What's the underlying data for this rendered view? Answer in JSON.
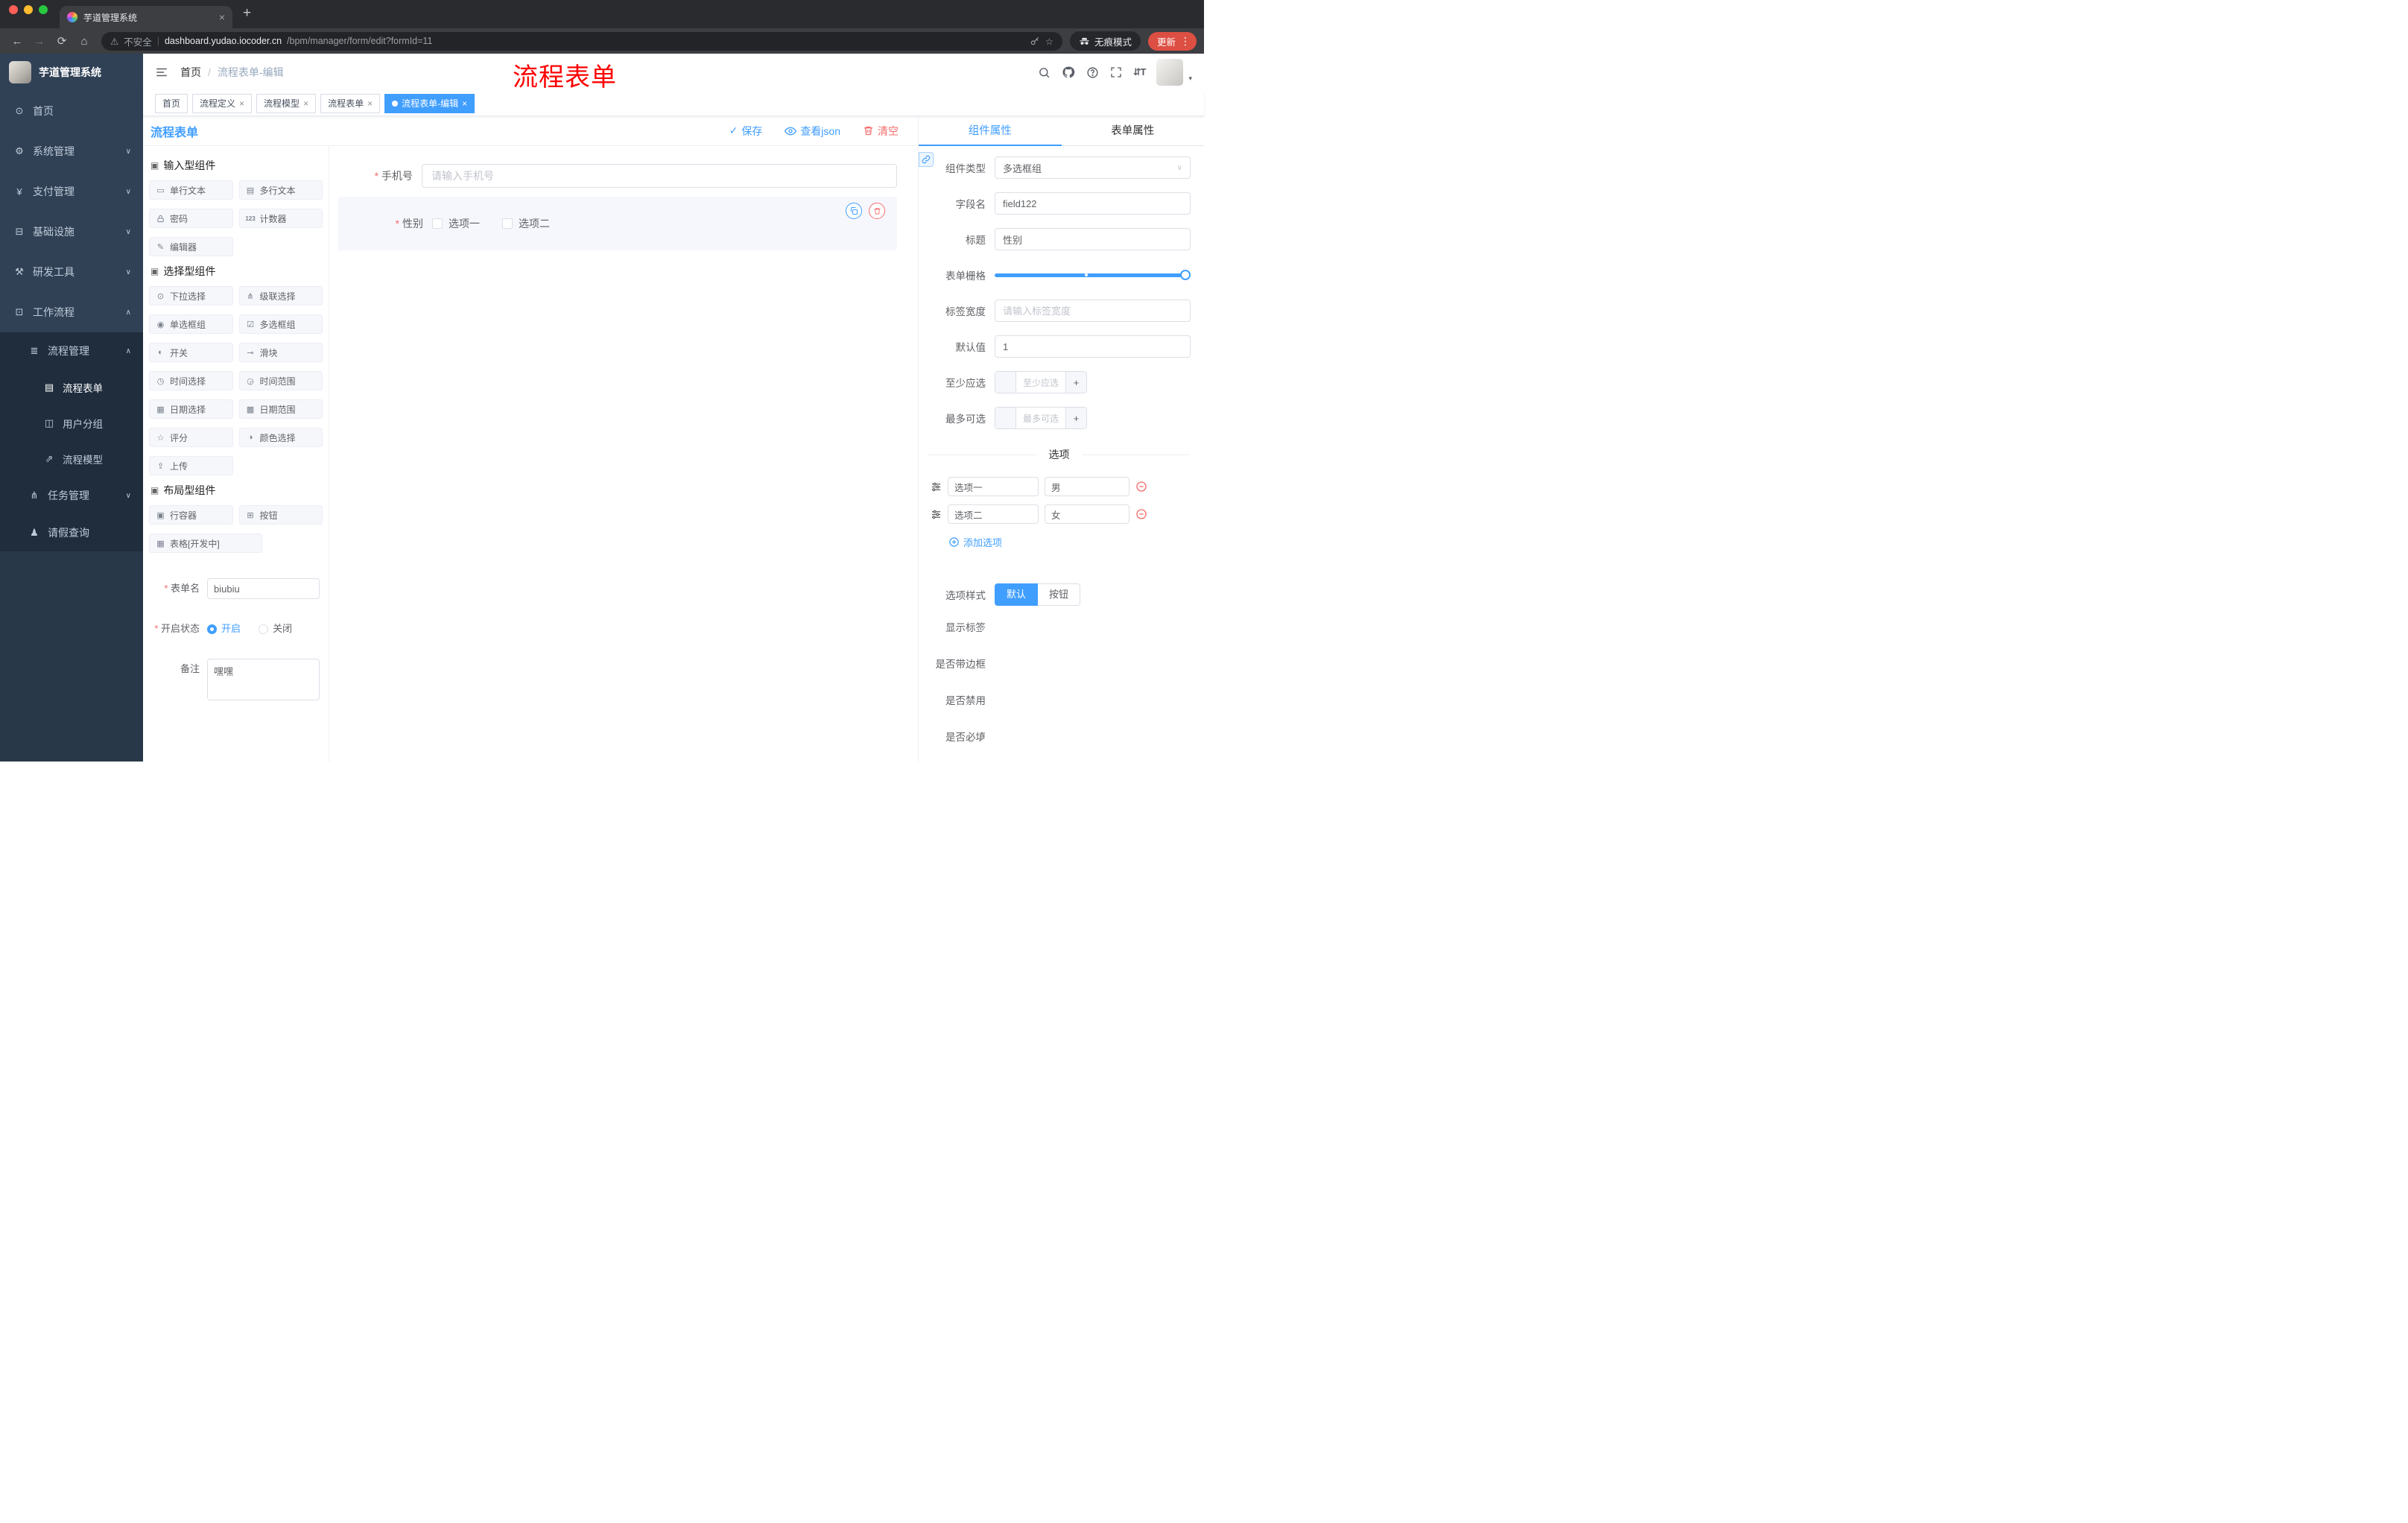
{
  "icons": {
    "close": "×",
    "new_tab": "+",
    "back": "←",
    "forward": "→",
    "reload": "⟳",
    "home_btn": "⌂",
    "warning": "⚠",
    "bookmark_star": "☆",
    "menu_dots": "⋮",
    "url_separator": "|",
    "breadcrumb_separator": "/",
    "dashboard": "⊙",
    "gear": "⚙",
    "yen": "¥",
    "monitor": "⊟",
    "tools": "⚒",
    "briefcase": "⊡",
    "list": "≣",
    "document": "▤",
    "users": "◫",
    "send": "⇗",
    "branch": "⋔",
    "person": "♟",
    "chevron_down": "∨",
    "chevron_up": "∧",
    "component_group": "▣",
    "check": "✓",
    "caret_down": "▾",
    "text_size": "⇵T",
    "chip_single_text": "▭",
    "chip_textarea": "▤",
    "chip_counter": "123",
    "chip_editor": "✎",
    "chip_select": "⊙",
    "chip_cascader": "⋔",
    "chip_radio": "◉",
    "chip_checkbox": "☑",
    "chip_switch": "◐",
    "chip_slider": "⊸",
    "chip_time": "◷",
    "chip_time_range": "◶",
    "chip_date": "▦",
    "chip_date_range": "▩",
    "chip_rate": "☆",
    "chip_color": "◑",
    "chip_upload": "⇪",
    "chip_row": "▣",
    "chip_button": "⊞",
    "chip_table": "▦"
  },
  "browser": {
    "tab_title": "芋道管理系统",
    "security_label": "不安全",
    "url_domain": "dashboard.yudao.iocoder.cn",
    "url_path": "/bpm/manager/form/edit?formId=11",
    "incognito_label": "无痕模式",
    "update_label": "更新"
  },
  "annotation": "流程表单",
  "sidebar": {
    "logo_title": "芋道管理系统",
    "items": {
      "home": "首页",
      "system": "系统管理",
      "payment": "支付管理",
      "infra": "基础设施",
      "devtools": "研发工具",
      "workflow": "工作流程",
      "process_mgmt": "流程管理",
      "process_form": "流程表单",
      "user_group": "用户分组",
      "process_model": "流程模型",
      "task_mgmt": "任务管理",
      "leave_query": "请假查询"
    }
  },
  "header": {
    "breadcrumb_home": "首页",
    "breadcrumb_current": "流程表单-编辑"
  },
  "tags": {
    "home": "首页",
    "def": "流程定义",
    "model": "流程模型",
    "form": "流程表单",
    "edit": "流程表单-编辑"
  },
  "designer": {
    "title": "流程表单",
    "save": "保存",
    "view_json": "查看json",
    "clear": "清空",
    "groups": {
      "input": {
        "title": "输入型组件",
        "items": [
          "单行文本",
          "多行文本",
          "密码",
          "计数器",
          "编辑器"
        ]
      },
      "select": {
        "title": "选择型组件",
        "items": [
          "下拉选择",
          "级联选择",
          "单选框组",
          "多选框组",
          "开关",
          "滑块",
          "时间选择",
          "时间范围",
          "日期选择",
          "日期范围",
          "评分",
          "颜色选择",
          "上传"
        ]
      },
      "layout": {
        "title": "布局型组件",
        "items": [
          "行容器",
          "按钮",
          "表格[开发中]"
        ]
      }
    },
    "meta": {
      "form_name_label": "表单名",
      "form_name_value": "biubiu",
      "status_label": "开启状态",
      "status_on": "开启",
      "status_off": "关闭",
      "remark_label": "备注",
      "remark_value": "嘿嘿"
    },
    "canvas": {
      "phone_label": "手机号",
      "phone_placeholder": "请输入手机号",
      "gender_label": "性别",
      "gender_options": [
        "选项一",
        "选项二"
      ]
    }
  },
  "props": {
    "tab_component": "组件属性",
    "tab_form": "表单属性",
    "type_label": "组件类型",
    "type_value": "多选框组",
    "field_label": "字段名",
    "field_value": "field122",
    "title_label": "标题",
    "title_value": "性别",
    "grid_label": "表单栅格",
    "width_label": "标签宽度",
    "width_placeholder": "请输入标签宽度",
    "default_label": "默认值",
    "default_value": "1",
    "min_label": "至少应选",
    "min_placeholder": "至少应选",
    "max_label": "最多可选",
    "max_placeholder": "最多可选",
    "options_divider": "选项",
    "options": [
      {
        "label": "选项一",
        "value": "男"
      },
      {
        "label": "选项二",
        "value": "女"
      }
    ],
    "add_option": "添加选项",
    "style_label": "选项样式",
    "style_default": "默认",
    "style_button": "按钮",
    "toggle_show_label": "显示标签",
    "toggle_border": "是否带边框",
    "toggle_disabled": "是否禁用",
    "toggle_required": "是否必填",
    "toggle_states": {
      "show_label": true,
      "border": false,
      "disabled": false,
      "required": true
    },
    "colors": {
      "primary": "#409eff",
      "danger": "#f56c6c"
    }
  }
}
